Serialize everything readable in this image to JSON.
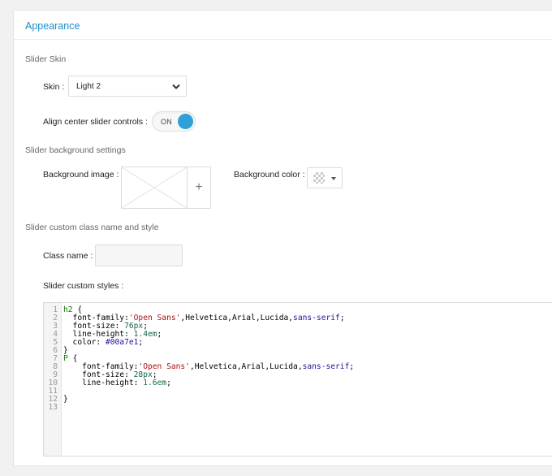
{
  "panel": {
    "title": "Appearance"
  },
  "sections": {
    "skin": "Slider Skin",
    "background": "Slider background settings",
    "custom": "Slider custom class name and style"
  },
  "skin": {
    "label": "Skin :",
    "value": "Light 2"
  },
  "align": {
    "label": "Align center slider controls :",
    "toggle_text": "ON",
    "state": "on"
  },
  "background": {
    "image_label": "Background image :",
    "color_label": "Background color :",
    "add_icon": "plus-icon"
  },
  "class_name": {
    "label": "Class name :",
    "value": ""
  },
  "custom_styles": {
    "label": "Slider custom styles :",
    "lines": [
      [
        [
          "sel",
          "h2 "
        ],
        [
          "punc",
          "{"
        ]
      ],
      [
        [
          "prop",
          "  font-family:"
        ],
        [
          "str",
          "'Open Sans'"
        ],
        [
          "prop",
          ",Helvetica,Arial,Lucida,"
        ],
        [
          "kw",
          "sans-serif"
        ],
        [
          "punc",
          ";"
        ]
      ],
      [
        [
          "prop",
          "  font-size: "
        ],
        [
          "num",
          "76px"
        ],
        [
          "punc",
          ";"
        ]
      ],
      [
        [
          "prop",
          "  line-height: "
        ],
        [
          "num",
          "1.4em"
        ],
        [
          "punc",
          ";"
        ]
      ],
      [
        [
          "prop",
          "  color: "
        ],
        [
          "kw",
          "#00a7e1"
        ],
        [
          "punc",
          ";"
        ]
      ],
      [
        [
          "punc",
          "}"
        ]
      ],
      [
        [
          "sel",
          "P "
        ],
        [
          "punc",
          "{"
        ]
      ],
      [
        [
          "prop",
          "    font-family:"
        ],
        [
          "str",
          "'Open Sans'"
        ],
        [
          "prop",
          ",Helvetica,Arial,Lucida,"
        ],
        [
          "kw",
          "sans-serif"
        ],
        [
          "punc",
          ";"
        ]
      ],
      [
        [
          "prop",
          "    font-size: "
        ],
        [
          "num",
          "28px"
        ],
        [
          "punc",
          ";"
        ]
      ],
      [
        [
          "prop",
          "    line-height: "
        ],
        [
          "num",
          "1.6em"
        ],
        [
          "punc",
          ";"
        ]
      ],
      [],
      [
        [
          "punc",
          "}"
        ]
      ],
      []
    ]
  },
  "colors": {
    "accent": "#2ea2d6",
    "title": "#1a8fc9",
    "selector": "#117700",
    "string": "#aa1111",
    "number": "#116644",
    "keyword": "#221199"
  }
}
